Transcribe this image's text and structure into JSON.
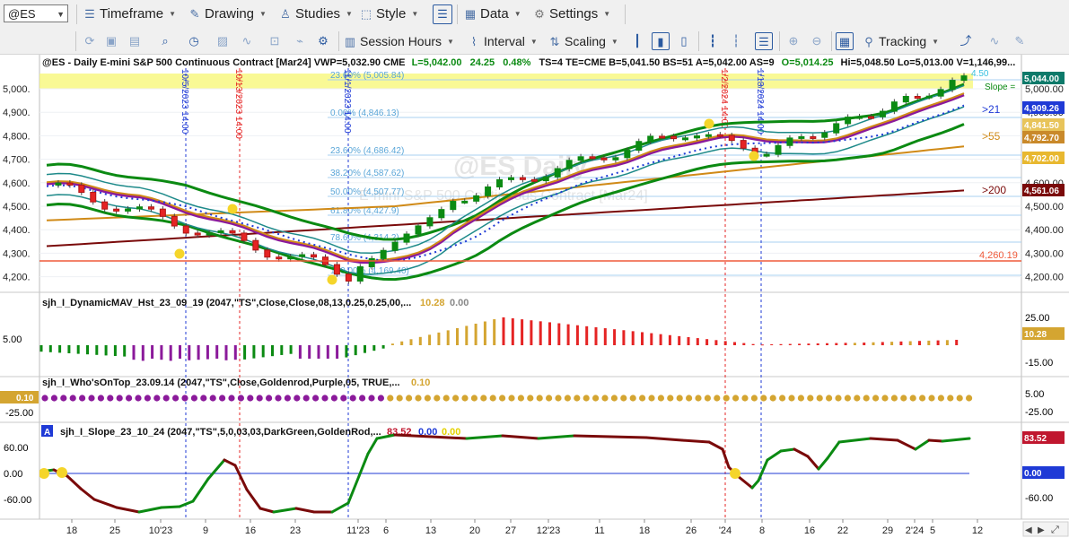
{
  "toolbar": {
    "symbol": "@ES",
    "timeframe": "Timeframe",
    "drawing": "Drawing",
    "studies": "Studies",
    "style": "Style",
    "data": "Data",
    "settings": "Settings",
    "session_hours": "Session Hours",
    "interval": "Interval",
    "scaling": "Scaling",
    "tracking": "Tracking"
  },
  "header": {
    "text": "@ES - Daily  E-mini S&P 500 Continuous Contract [Mar24]  VWP=5,032.90  CME",
    "last": "L=5,042.00",
    "change": "24.25",
    "pct": "0.48%",
    "rest": "TS=4  TE=CME  B=5,041.50  BS=51  A=5,042.00  AS=9",
    "open": "O=5,014.25",
    "hilo": "Hi=5,048.50  Lo=5,013.00  V=1,146,99..."
  },
  "watermark": "@ES Daily",
  "watermark2": "E-mini S&P 500 Continuous Contract [Mar24]",
  "price_axis": [
    "5,000.",
    "4,900.",
    "4,800.",
    "4,700.",
    "4,600.",
    "4,500.",
    "4,400.",
    "4,300.",
    "4,200."
  ],
  "right_axis": [
    "5,000.00",
    "4,900.00",
    "4,800.00",
    "4,700.00",
    "4,600.00",
    "4,500.00",
    "4,400.00",
    "4,300.00",
    "4,200.00"
  ],
  "right_badges": {
    "p1": "5,044.00",
    "p2": "4,909.26",
    "p3": "4,841.50",
    "p4": "4,792.70",
    "p5": "4,702.00",
    "p6": "4,561.06",
    "top_val": "4.50",
    "slope": "Slope ="
  },
  "ma_labels": {
    "m21": ">21",
    "m55": ">55",
    "m200": ">200"
  },
  "fib_labels": [
    "23.60% (5,005.84)",
    "0.00% (4,846.13)",
    "23.60% (4,686.42)",
    "38.20% (4,587.62)",
    "50.00% (4,507.77)",
    "61.80% (4,427.9)",
    "78.60% (4,314.2)",
    "100.00% (4,169.40)"
  ],
  "support_label": "4,260.19",
  "vertical_labels": [
    "10/5/2023 14:00",
    "10/13/2023 14:00",
    "11/1/2023 14:00",
    "1/2/2024 14:00",
    "1/18/2024 14:00"
  ],
  "indicator1": {
    "title": "sjh_I_DynamicMAV_Hst_23_09_19 (2047,\"TS\",Close,Close,08,13,0.25,0.25,00,...",
    "v1": "10.28",
    "v2": "0.00",
    "axis": [
      "25.00",
      "5.00",
      "-15.00"
    ],
    "badge": "10.28"
  },
  "indicator2": {
    "title": "sjh_I_Who'sOnTop_23.09.14 (2047,\"TS\",Close,Goldenrod,Purple,05,  TRUE,...",
    "v1": "0.10",
    "axis": [
      "5.00",
      "-25.00"
    ],
    "badge": "0.10",
    "left_axis": "-25.00"
  },
  "indicator3": {
    "badge_a": "A",
    "title": "sjh_I_Slope_23_10_24 (2047,\"TS\",5,0,03,03,DarkGreen,GoldenRod,...",
    "v1": "83.52",
    "v2": "0.00",
    "v3": "0.00",
    "axis": [
      "60.00",
      "0.00",
      "-60.00"
    ],
    "left_axis": [
      "60.00",
      "0.00",
      "-60.00"
    ],
    "badge1": "83.52",
    "badge2": "0.00"
  },
  "time_axis": [
    "18",
    "25",
    "10'23",
    "9",
    "16",
    "23",
    "11'23",
    "6",
    "13",
    "20",
    "27",
    "12'23",
    "11",
    "18",
    "26",
    "'24",
    "8",
    "16",
    "22",
    "29",
    "2'24",
    "5",
    "12"
  ],
  "colors": {
    "bg": "#ffffff",
    "green": "#0b8a12",
    "maroon": "#7a0a0a",
    "orange": "#d08a17",
    "purple": "#8b1a9b",
    "blue": "#1f3ad6",
    "teal": "#1e8a8a",
    "red_bar": "#e52424",
    "gold_bar": "#d4a531"
  }
}
